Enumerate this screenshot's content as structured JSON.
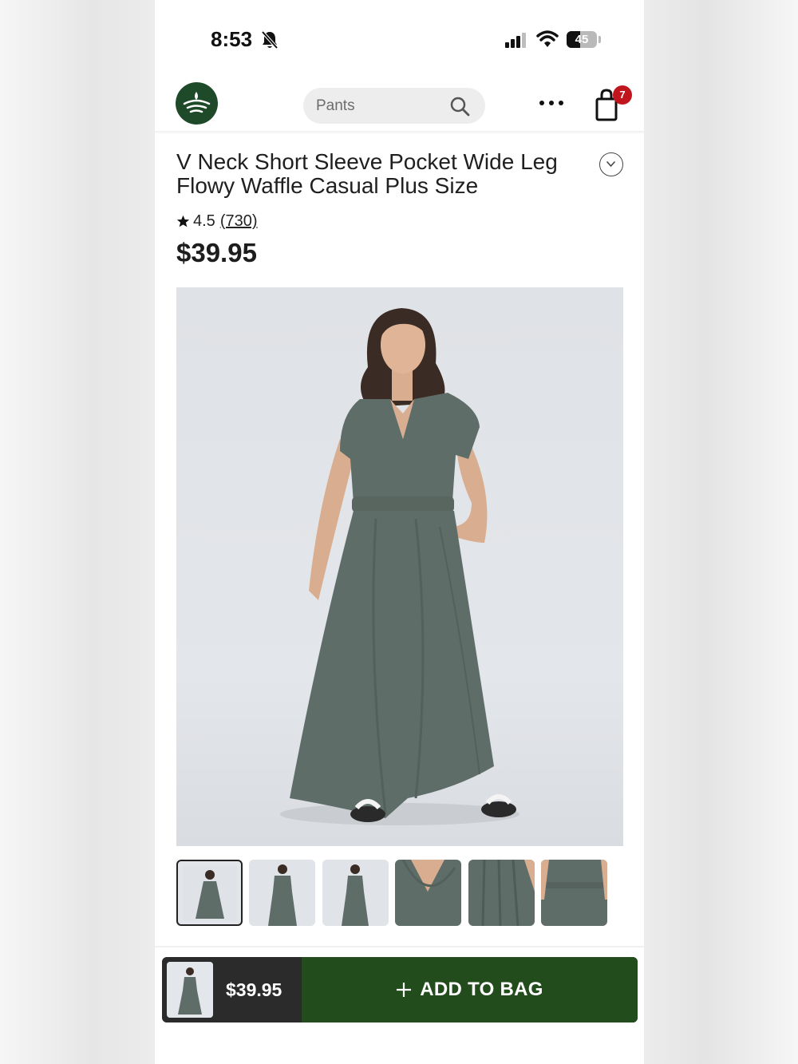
{
  "status_bar": {
    "time": "8:53",
    "battery": "45",
    "battery_level": 0.45,
    "icons": [
      "bell-slash-icon",
      "cellular-signal-icon",
      "wifi-icon",
      "battery-icon"
    ]
  },
  "header": {
    "logo_icon": "brand-logo-icon",
    "search": {
      "placeholder": "Pants",
      "icon": "search-icon"
    },
    "more_icon": "more-horizontal-icon",
    "cart": {
      "icon": "shopping-bag-icon",
      "badge_count": "7"
    }
  },
  "product": {
    "title": "V Neck Short Sleeve Pocket Wide Leg Flowy Waffle Casual Plus Size",
    "expand_icon": "chevron-down-icon",
    "rating": "4.5",
    "review_count": "(730)",
    "price": "$39.95",
    "image_count": 6,
    "selected_thumbnail": 1
  },
  "sticky_bar": {
    "price": "$39.95",
    "add_to_bag": "ADD TO BAG",
    "plus_icon": "plus-icon"
  },
  "colors": {
    "brand_green": "#1f4a2a",
    "button_green": "#234c1d",
    "badge_red": "#c0151c",
    "garment": "#5f6d69"
  }
}
